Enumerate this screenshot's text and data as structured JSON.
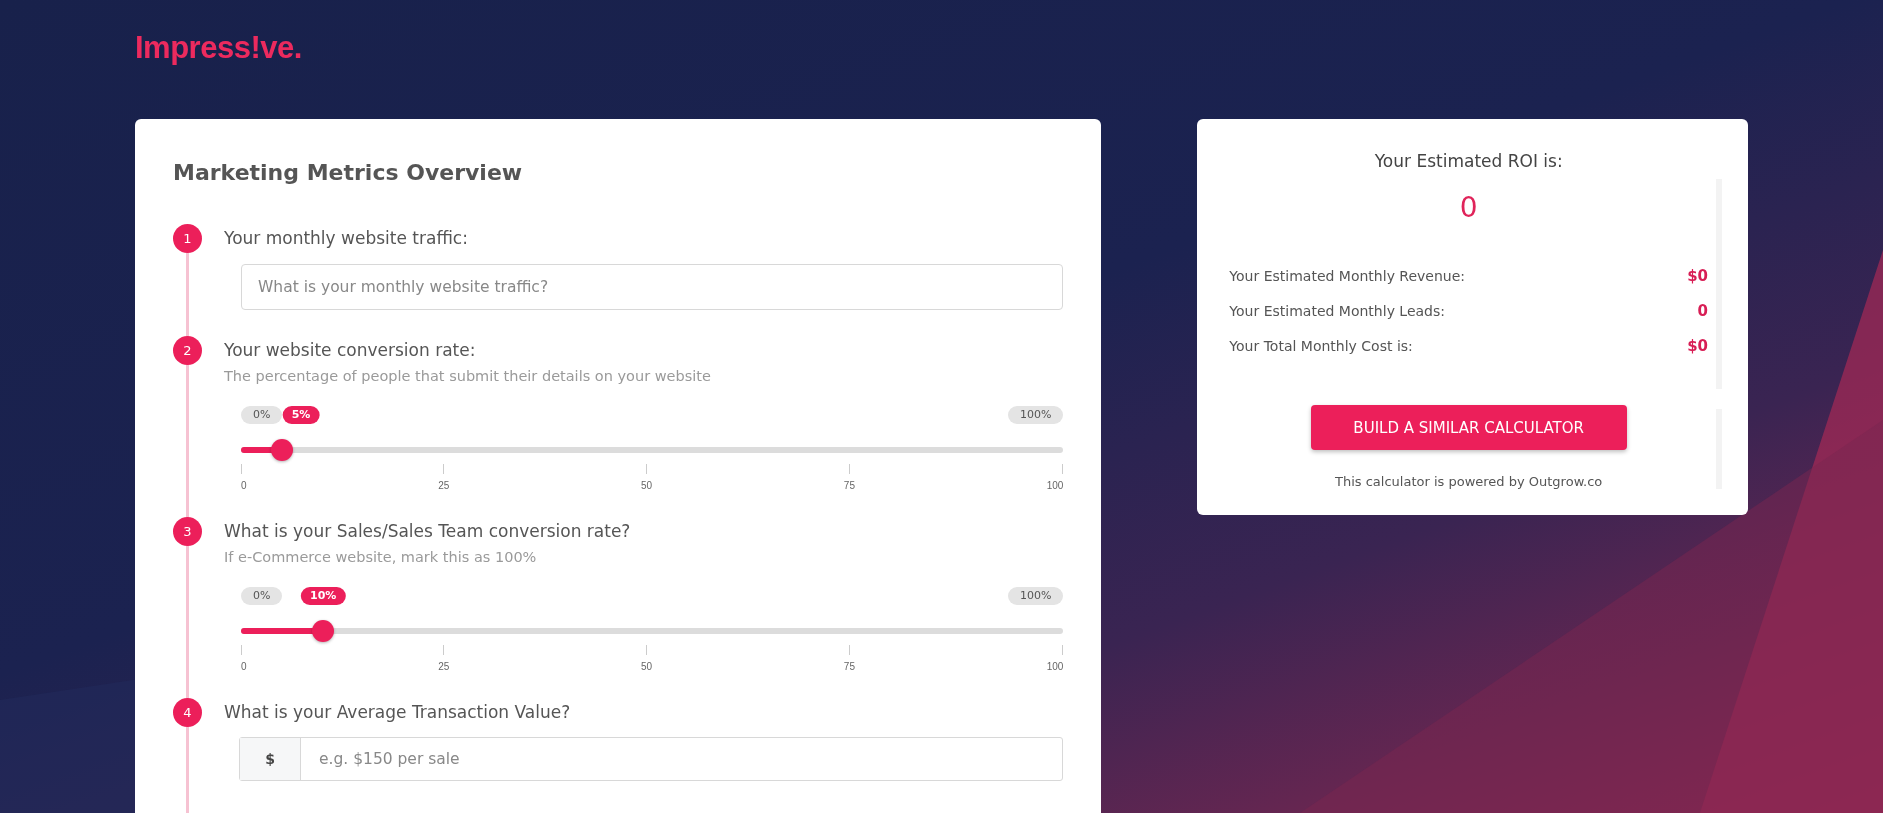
{
  "logo": "Impress!ve.",
  "calculator": {
    "title": "Marketing Metrics Overview",
    "steps": [
      {
        "number": "1",
        "kind": "text-input",
        "label": "Your monthly website traffic:",
        "placeholder": "What is your monthly website traffic?"
      },
      {
        "number": "2",
        "kind": "slider",
        "label": "Your website conversion rate:",
        "hint": "The percentage of people that submit their details on your website",
        "min_label": "0%",
        "max_label": "100%",
        "value_label": "5%",
        "level": 0.05,
        "ticks": [
          "0",
          "25",
          "50",
          "75",
          "100"
        ]
      },
      {
        "number": "3",
        "kind": "slider",
        "label": "What is your Sales/Sales Team conversion rate?",
        "hint": "If e-Commerce website, mark this as 100%",
        "min_label": "0%",
        "max_label": "100%",
        "value_label": "10%",
        "level": 0.1,
        "ticks": [
          "0",
          "25",
          "50",
          "75",
          "100"
        ]
      },
      {
        "number": "4",
        "kind": "prefixed-input",
        "label": "What is your Average Transaction Value?",
        "prefix": "$",
        "placeholder": "e.g. $150 per sale"
      }
    ]
  },
  "results": {
    "title": "Your Estimated ROI is:",
    "roi": "0",
    "rows": [
      {
        "label": "Your Estimated Monthly Revenue:",
        "value": "$0"
      },
      {
        "label": "Your Estimated Monthly Leads:",
        "value": "0"
      },
      {
        "label": "Your Total Monthly Cost is:",
        "value": "$0"
      }
    ],
    "button": "BUILD A SIMILAR CALCULATOR",
    "footer": "This calculator is powered by Outgrow.co"
  }
}
